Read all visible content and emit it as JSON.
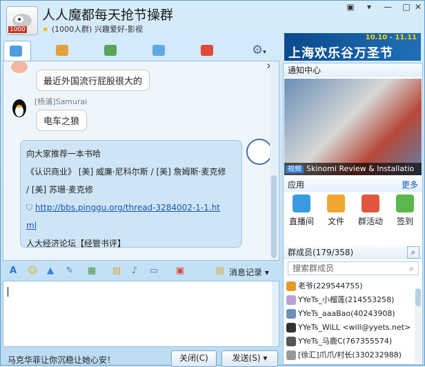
{
  "window": {
    "title": "人人魔都每天抢节操群",
    "subtitle": "(1000人群) 兴趣爱好-影视",
    "avatar_badge": "1000"
  },
  "tabs": [
    {
      "label": "聊天"
    },
    {
      "label": "公告"
    },
    {
      "label": "相册"
    },
    {
      "label": "文件"
    },
    {
      "label": "活动"
    }
  ],
  "ad": {
    "dates": "10.10 - 11.11",
    "text": "上海欢乐谷万圣节"
  },
  "chat": {
    "messages": [
      {
        "text": "最近外国流行屁股很大的"
      },
      {
        "sender": "[杨浦]Samurai",
        "text": "电车之狼"
      }
    ],
    "rich": {
      "line1": "向大家推荐一本书哈",
      "line2": "《认识商业》 [美] 威廉·尼科尔斯 / [美] 詹姆斯·麦克修",
      "line3": "/ [美] 苏珊·麦克修",
      "link1": "http://bbs.pinggu.org/thread-3284002-1-1.ht",
      "link2": "ml",
      "line4": "人大经济论坛【经管书评】"
    }
  },
  "input_toolbar": {
    "history_label": "消息记录"
  },
  "footer": {
    "status_text": "马克华菲让你沉稳让她心安！",
    "close_label": "关闭(C)",
    "send_label": "发送(S)"
  },
  "right": {
    "notice_title": "通知中心",
    "notice_tag": "视频",
    "notice_caption": "Skinomi Review & Installatio",
    "apps_title": "应用",
    "more_label": "更多",
    "apps": [
      {
        "label": "直播间"
      },
      {
        "label": "文件"
      },
      {
        "label": "群活动"
      },
      {
        "label": "签到"
      }
    ],
    "members_title": "群成员(179/358)",
    "search_placeholder": "搜索群成员",
    "members": [
      "老爷(229544755)",
      "YYeTs_小榴莲(214553258)",
      "YYeTs_aaaBao(40243908)",
      "YYeTs_WiLL <will@yyets.net>",
      "YYeTs_马鹿C(767355574)",
      "[徐汇]爪爪/村长(330232988)"
    ]
  }
}
